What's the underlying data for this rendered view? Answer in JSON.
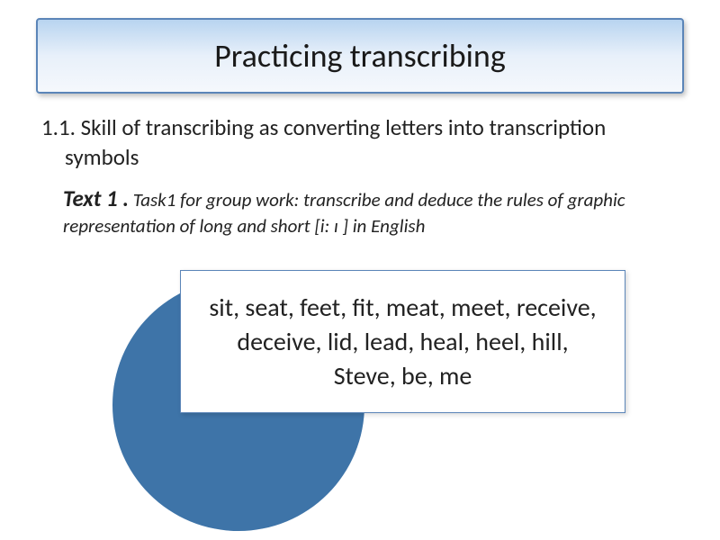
{
  "title": "Practicing transcribing",
  "section": {
    "heading": "1.1. Skill of transcribing as converting letters into transcription symbols"
  },
  "task": {
    "label": "Text  1 .",
    "description": "Task1 for group work: transcribe and  deduce the rules of graphic representation of long and short [i: ɪ ]  in English"
  },
  "wordbox": {
    "content": "sit, seat, feet, fit,  meat, meet, receive,  deceive, lid, lead, heal, heel, hill, Steve,  be, me"
  }
}
